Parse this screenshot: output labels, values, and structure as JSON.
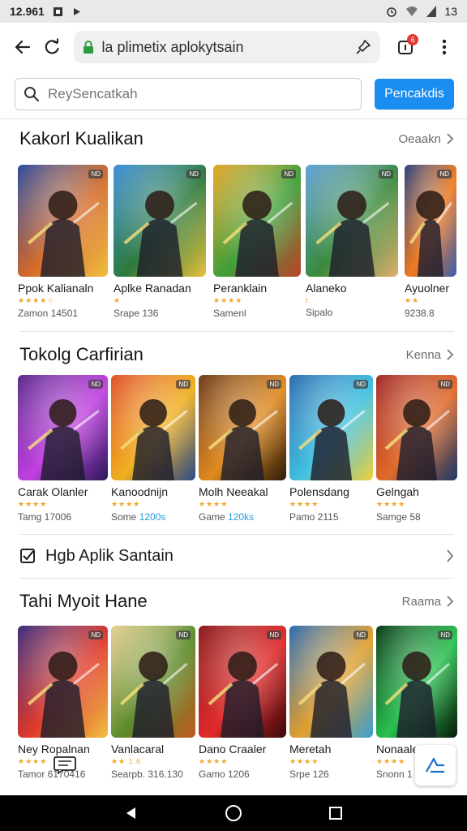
{
  "status": {
    "time": "12.961",
    "right_text": "13"
  },
  "browser": {
    "url": "la plimetix aplokytsain",
    "tab_count": "6"
  },
  "search": {
    "placeholder": "ReySencatkah",
    "button_label": "Pencakdis"
  },
  "sections": [
    {
      "title": "Kakorl Kualikan",
      "more": "Oeaakn",
      "cards": [
        {
          "name": "Ppok Kalianaln",
          "stars": "★★★★☆",
          "meta": "Zamon 14501",
          "tag": "ND"
        },
        {
          "name": "Aplke Ranadan",
          "stars": "★",
          "meta": "Srape 136",
          "tag": "ND"
        },
        {
          "name": "Peranklain",
          "stars": "★★★★",
          "meta": "Samenl",
          "tag": "ND"
        },
        {
          "name": "Alaneko",
          "stars": "r.",
          "meta": "Sipalo",
          "tag": "ND"
        },
        {
          "name": "Ayuolner",
          "stars": "★★",
          "meta": "9238.8",
          "tag": "ND"
        }
      ]
    },
    {
      "title": "Tokolg Carfirian",
      "more": "Kenna",
      "cards": [
        {
          "name": "Carak Olanler",
          "stars": "★★★★",
          "meta": "Tamg 17006",
          "tag": "ND"
        },
        {
          "name": "Kanoodnijn",
          "stars": "★★★★",
          "meta": "Some",
          "meta_hl": "1200s",
          "tag": "ND"
        },
        {
          "name": "Molh Neeakal",
          "stars": "★★★★",
          "meta": "Game",
          "meta_hl": "120ks",
          "tag": "ND"
        },
        {
          "name": "Polensdang",
          "stars": "★★★★",
          "meta": "Pamo 2115",
          "tag": "ND"
        },
        {
          "name": "Gelngah",
          "stars": "★★★★",
          "meta": "Samge 58",
          "tag": "ND"
        }
      ]
    },
    {
      "title": "Tahi Myoit Hane",
      "more": "Raama",
      "cards": [
        {
          "name": "Ney Ropalnan",
          "stars": "★★★★",
          "meta": "Tamor 6170416",
          "tag": "ND"
        },
        {
          "name": "Vanlacaral",
          "stars": "★★ 1.6",
          "meta": "Searpb. 316.130",
          "tag": "ND"
        },
        {
          "name": "Dano Craaler",
          "stars": "★★★★",
          "meta": "Gamo 1206",
          "tag": "ND"
        },
        {
          "name": "Meretah",
          "stars": "★★★★",
          "meta": "Srpe 126",
          "tag": "ND"
        },
        {
          "name": "Nonaale",
          "stars": "★★★★",
          "meta": "Snonn 1",
          "tag": "ND"
        }
      ]
    }
  ],
  "list_item": {
    "label": "Hgb Aplik Santain"
  },
  "colors": {
    "accent": "#1a8df0",
    "star": "#f2a623",
    "highlight": "#2a9ad6"
  }
}
